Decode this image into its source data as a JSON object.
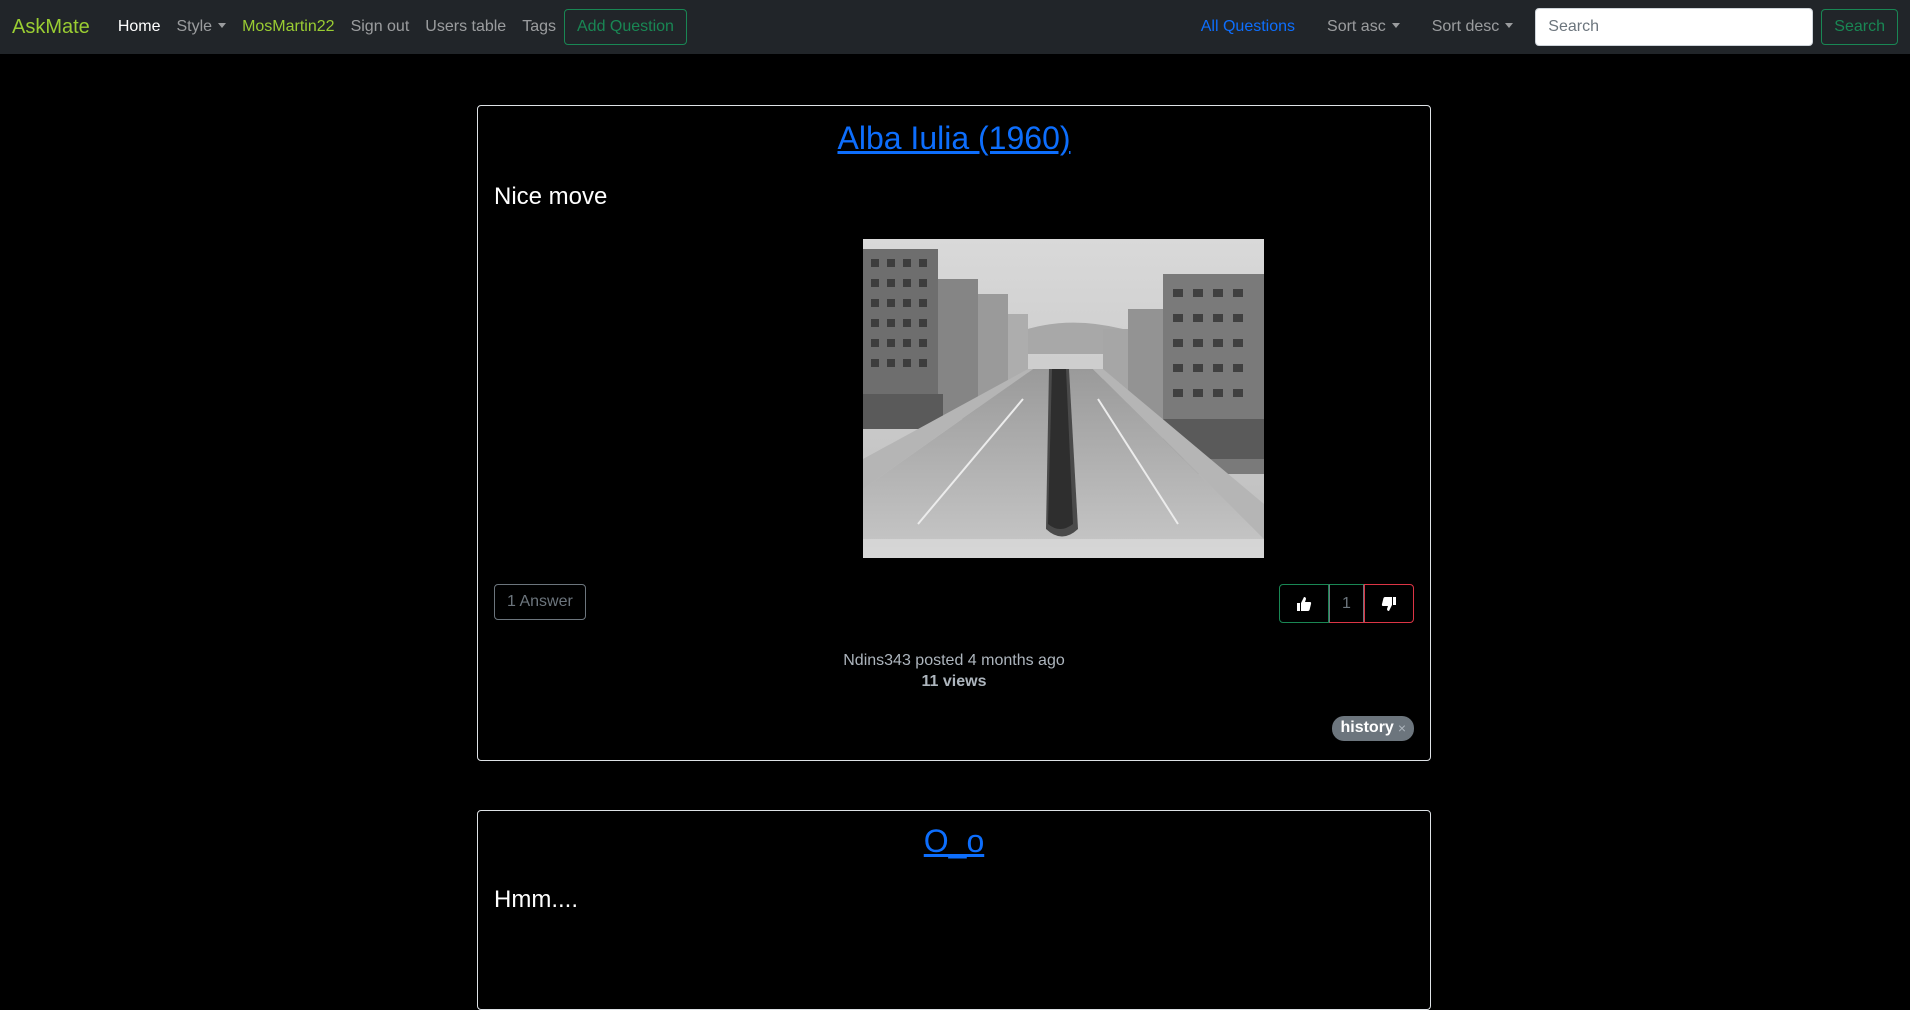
{
  "navbar": {
    "brand": "AskMate",
    "links": {
      "home": "Home",
      "style": "Style",
      "user": "MosMartin22",
      "sign_out": "Sign out",
      "users_table": "Users table",
      "tags": "Tags"
    },
    "add_question": "Add Question",
    "right": {
      "all_questions": "All Questions",
      "sort_asc": "Sort asc",
      "sort_desc": "Sort desc",
      "search_placeholder": "Search",
      "search_button": "Search"
    }
  },
  "questions": [
    {
      "title": "Alba Iulia (1960)",
      "body": "Nice move",
      "answers_label": "1 Answer",
      "votes": "1",
      "author_line": "Ndins343 posted 4 months ago",
      "views": "11 views",
      "tag": "history",
      "tag_remove": "×"
    },
    {
      "title": "O_o",
      "body": "Hmm...."
    }
  ],
  "colors": {
    "navbar_bg": "#212529",
    "brand": "#9acd32",
    "link_primary": "#0d6efd",
    "success": "#198754",
    "danger": "#dc3545",
    "muted": "#6c757d"
  }
}
